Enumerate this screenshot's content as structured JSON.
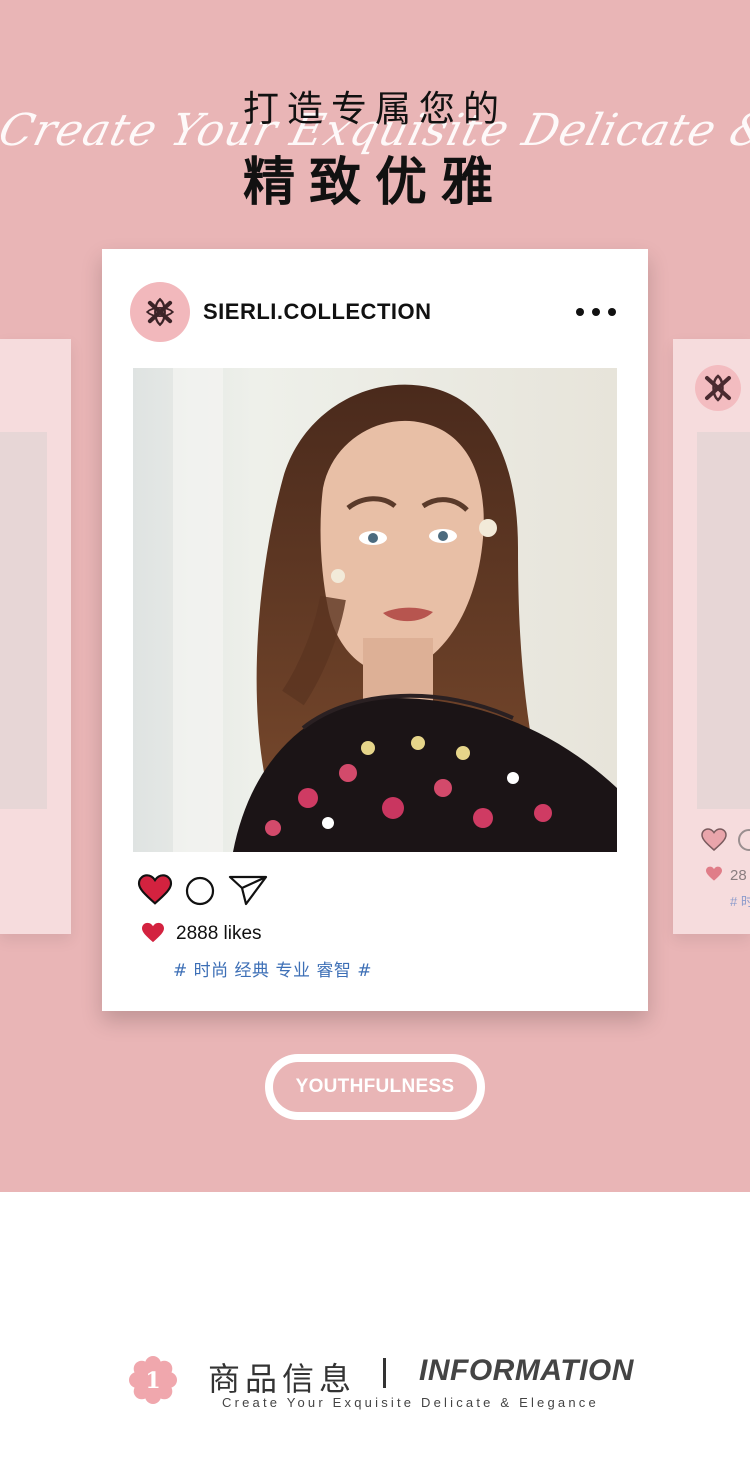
{
  "hero": {
    "title_top": "打造专属您的",
    "title_main": "精致优雅",
    "script_text": "Create Your Exquisite Delicate & Elegance"
  },
  "post": {
    "username": "SIERLI.COLLECTION",
    "likes": "2888 likes",
    "hashtags": "# 时尚 经典 专业 睿智 #",
    "icons": [
      "logo-icon",
      "more-icon",
      "heart-icon",
      "comment-icon",
      "share-icon"
    ]
  },
  "side_card_right": {
    "likes_partial": "28",
    "tag_partial": "# 时"
  },
  "badge_button": {
    "label": "YOUTHFULNESS"
  },
  "info": {
    "number": "1",
    "title_cn": "商品信息",
    "title_en": "INFORMATION",
    "subtitle": "Create Your Exquisite Delicate & Elegance"
  },
  "colors": {
    "background_pink": "#e9b5b6",
    "card_white": "#ffffff",
    "heart_red": "#d3223f",
    "hashtag_blue": "#3d6fb6",
    "flower_pink": "#f0a7ad"
  }
}
